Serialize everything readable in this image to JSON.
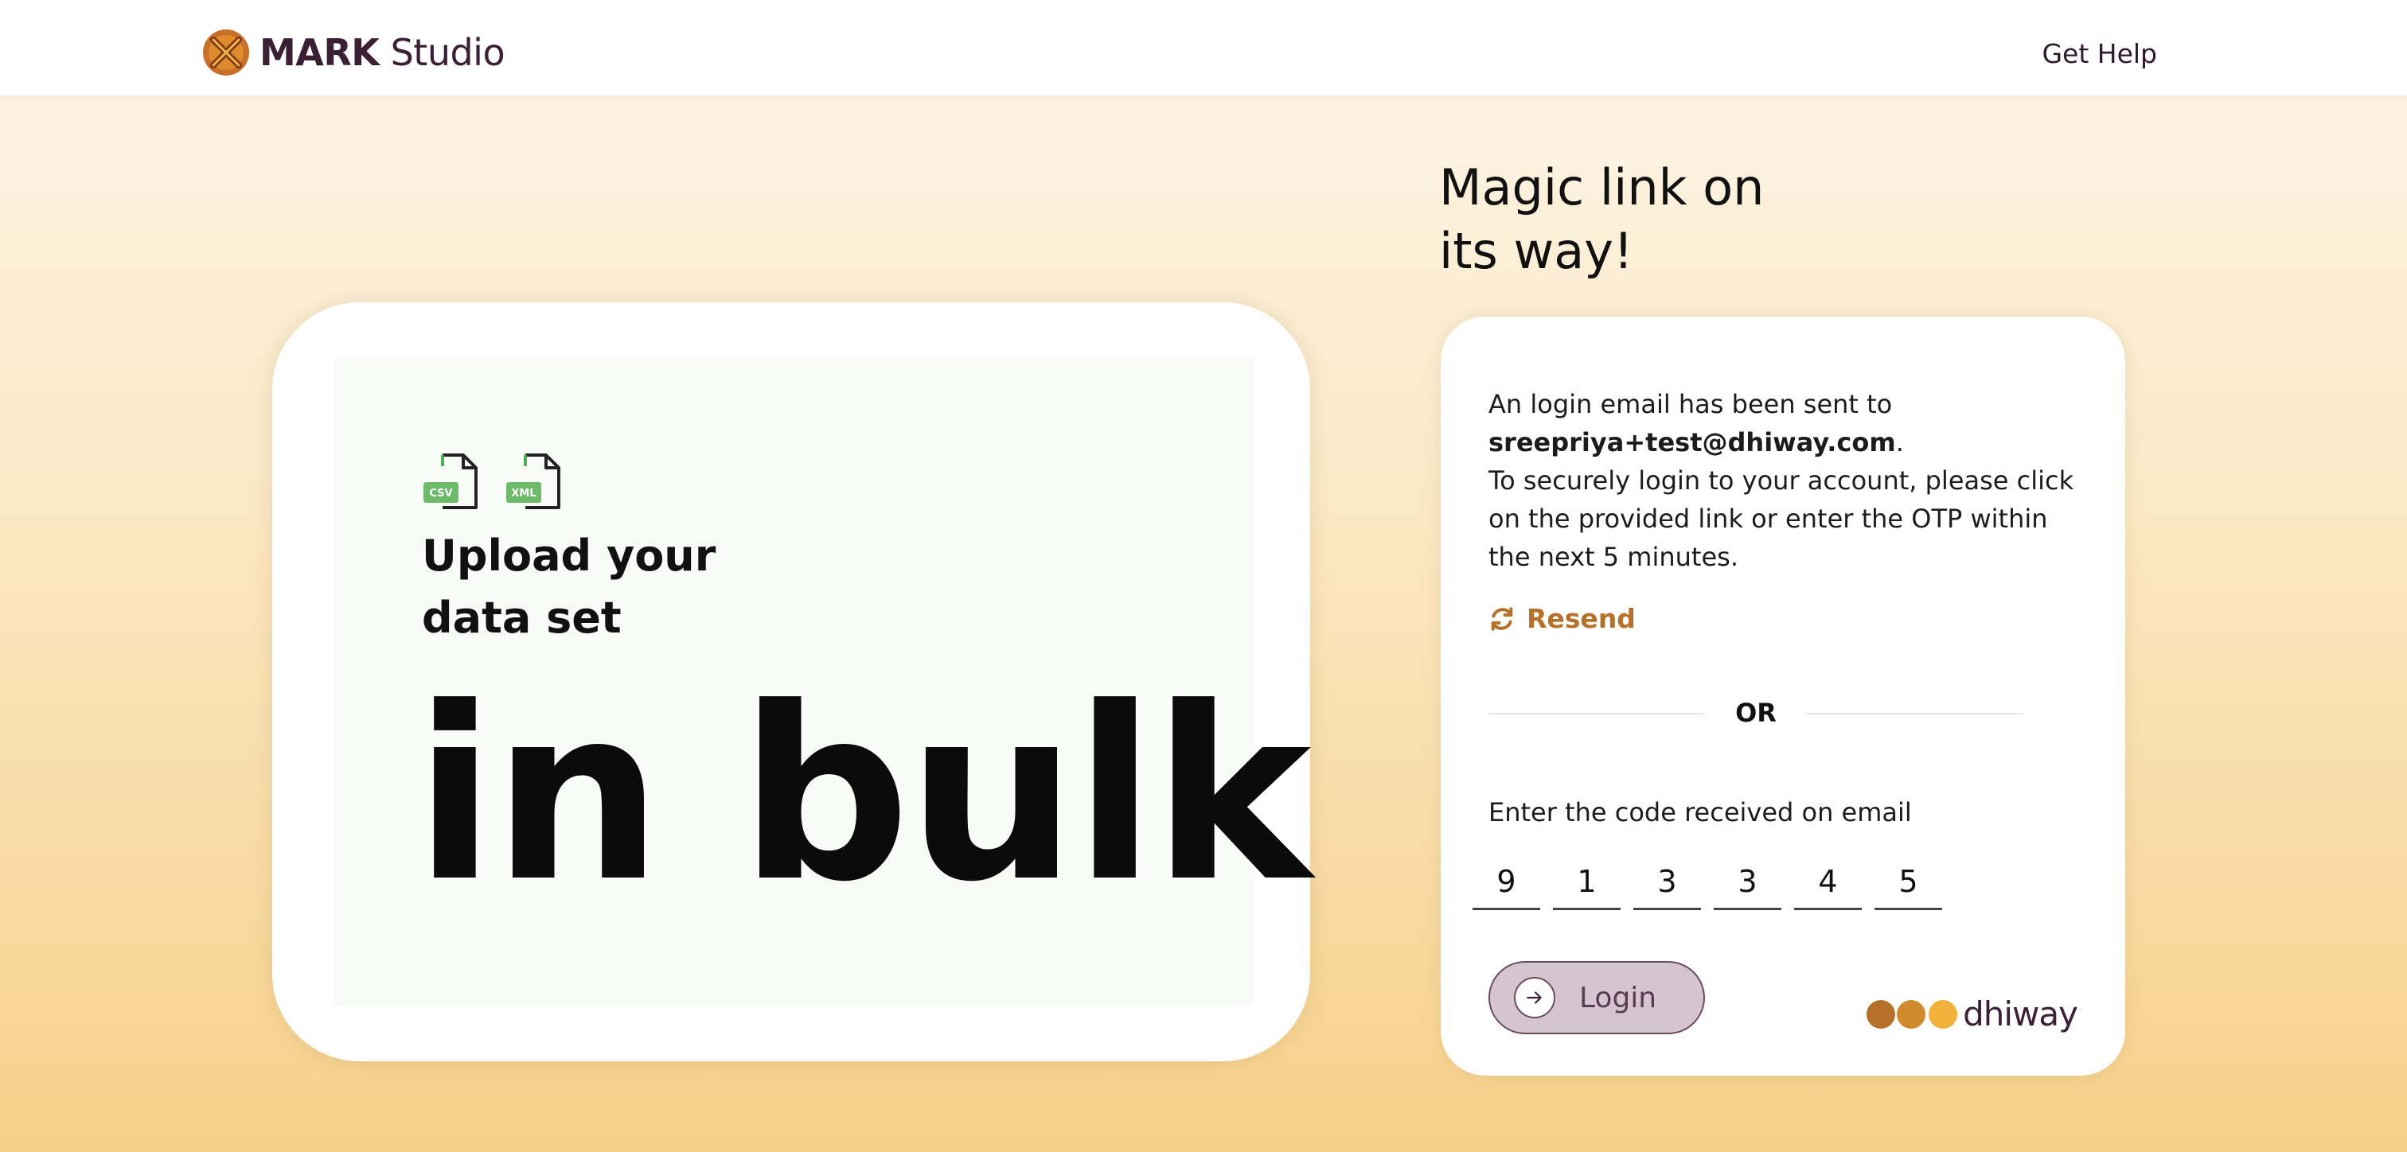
{
  "header": {
    "brand_bold": "MARK",
    "brand_light": "Studio",
    "help_link": "Get Help"
  },
  "promo": {
    "file_icons": [
      {
        "name": "csv-file-icon",
        "tag": "CSV"
      },
      {
        "name": "xml-file-icon",
        "tag": "XML"
      }
    ],
    "heading_line1": "Upload your",
    "heading_line2": "data set",
    "big_text": "in bulk"
  },
  "main": {
    "title_line1": "Magic link on",
    "title_line2": "its way!",
    "message_intro": "An login email has been sent to",
    "email": "sreepriya+test@dhiway.com",
    "email_suffix": ".",
    "message_body": "To securely login to your account, please click on the provided link or enter the OTP within the next 5 minutes.",
    "resend_label": "Resend",
    "divider_label": "OR",
    "code_label": "Enter the code received on email",
    "otp": [
      "9",
      "1",
      "3",
      "3",
      "4",
      "5"
    ],
    "login_label": "Login",
    "footer_logo_text": "dhiway"
  },
  "colors": {
    "brand": "#3b1f35",
    "accent": "#b5702a",
    "login_button_bg": "#d5c5cf",
    "dhiway_dot_1": "#b5702a",
    "dhiway_dot_2": "#d08a2c",
    "dhiway_dot_3": "#f0b23a"
  }
}
